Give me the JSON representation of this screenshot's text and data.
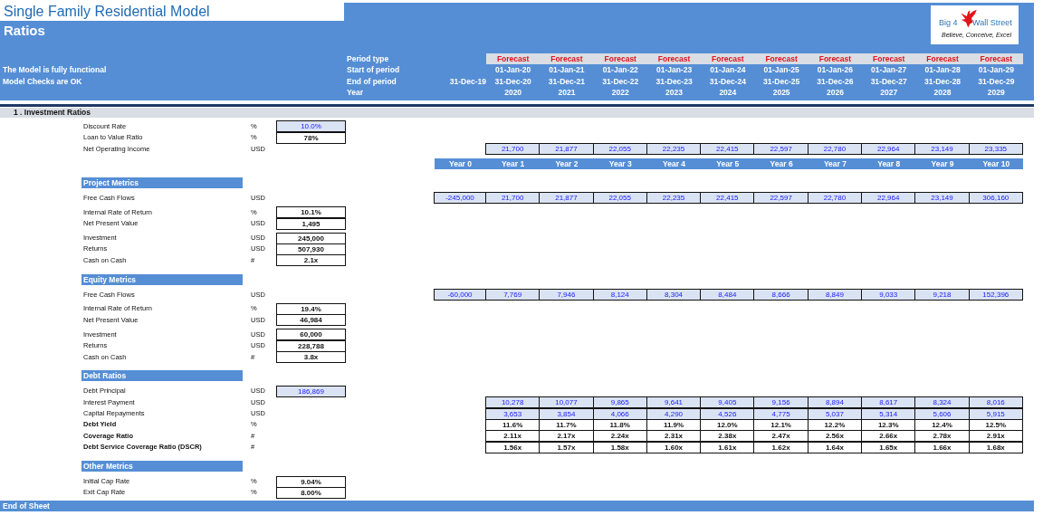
{
  "title": "Single Family Residential Model",
  "subtitle": "Ratios",
  "logo": {
    "left_text": "Big 4",
    "right_text": "Wall Street",
    "tagline": "Believe, Conceive, Excel"
  },
  "header_rows": [
    {
      "kind": "type",
      "note": "",
      "label": "Period type",
      "year0": "",
      "values": [
        "Forecast",
        "Forecast",
        "Forecast",
        "Forecast",
        "Forecast",
        "Forecast",
        "Forecast",
        "Forecast",
        "Forecast",
        "Forecast"
      ]
    },
    {
      "kind": "date",
      "note": "The Model is fully functional",
      "label": "Start of period",
      "year0": "",
      "values": [
        "01-Jan-20",
        "01-Jan-21",
        "01-Jan-22",
        "01-Jan-23",
        "01-Jan-24",
        "01-Jan-25",
        "01-Jan-26",
        "01-Jan-27",
        "01-Jan-28",
        "01-Jan-29"
      ]
    },
    {
      "kind": "date",
      "note": "Model Checks are OK",
      "label": "End of period",
      "year0": "31-Dec-19",
      "values": [
        "31-Dec-20",
        "31-Dec-21",
        "31-Dec-22",
        "31-Dec-23",
        "31-Dec-24",
        "31-Dec-25",
        "31-Dec-26",
        "31-Dec-27",
        "31-Dec-28",
        "31-Dec-29"
      ]
    },
    {
      "kind": "year",
      "note": "",
      "label": "Year",
      "year0": "",
      "values": [
        "2020",
        "2021",
        "2022",
        "2023",
        "2024",
        "2025",
        "2026",
        "2027",
        "2028",
        "2029"
      ]
    }
  ],
  "section": "1 . Investment Ratios",
  "inputs": [
    {
      "label": "Discount Rate",
      "unit": "%",
      "kind": "input",
      "label_bold": false,
      "value": "10.0%"
    },
    {
      "label": "Loan to Value Ratio",
      "unit": "%",
      "kind": "output",
      "label_bold": false,
      "value": "78%"
    },
    {
      "label": "Net Operating Income",
      "unit": "USD",
      "kind": "input",
      "label_bold": false,
      "series": [
        "21,700",
        "21,877",
        "22,055",
        "22,235",
        "22,415",
        "22,597",
        "22,780",
        "22,964",
        "23,149",
        "23,335"
      ]
    }
  ],
  "year_labels": [
    "Year 0",
    "Year 1",
    "Year 2",
    "Year 3",
    "Year 4",
    "Year 5",
    "Year 6",
    "Year 7",
    "Year 8",
    "Year 9",
    "Year 10"
  ],
  "metric_blocks": [
    {
      "heading": "Project Metrics",
      "groups": [
        [
          {
            "label": "Free Cash Flows",
            "unit": "USD",
            "kind": "input",
            "label_bold": false,
            "year0": "-245,000",
            "series": [
              "21,700",
              "21,877",
              "22,055",
              "22,235",
              "22,415",
              "22,597",
              "22,780",
              "22,964",
              "23,149",
              "306,160"
            ]
          }
        ],
        [
          {
            "label": "Internal Rate of Return",
            "unit": "%",
            "kind": "output",
            "label_bold": false,
            "value": "10.1%"
          },
          {
            "label": "Net Present Value",
            "unit": "USD",
            "kind": "output",
            "label_bold": false,
            "value": "1,495"
          }
        ],
        [
          {
            "label": "Investment",
            "unit": "USD",
            "kind": "output",
            "label_bold": false,
            "value": "245,000"
          },
          {
            "label": "Returns",
            "unit": "USD",
            "kind": "output",
            "label_bold": false,
            "value": "507,930"
          },
          {
            "label": "Cash on Cash",
            "unit": "#",
            "kind": "output",
            "label_bold": false,
            "value": "2.1x"
          }
        ]
      ]
    },
    {
      "heading": "Equity Metrics",
      "groups": [
        [
          {
            "label": "Free Cash Flows",
            "unit": "USD",
            "kind": "input",
            "label_bold": false,
            "year0": "-60,000",
            "series": [
              "7,769",
              "7,946",
              "8,124",
              "8,304",
              "8,484",
              "8,666",
              "8,849",
              "9,033",
              "9,218",
              "152,396"
            ]
          }
        ],
        [
          {
            "label": "Internal Rate of Return",
            "unit": "%",
            "kind": "output",
            "label_bold": false,
            "value": "19.4%"
          },
          {
            "label": "Net Present Value",
            "unit": "USD",
            "kind": "output",
            "label_bold": false,
            "value": "46,984"
          }
        ],
        [
          {
            "label": "Investment",
            "unit": "USD",
            "kind": "output",
            "label_bold": false,
            "value": "60,000"
          },
          {
            "label": "Returns",
            "unit": "USD",
            "kind": "output",
            "label_bold": false,
            "value": "228,788"
          },
          {
            "label": "Cash on Cash",
            "unit": "#",
            "kind": "output",
            "label_bold": false,
            "value": "3.8x"
          }
        ]
      ]
    },
    {
      "heading": "Debt Ratios",
      "groups": [
        [
          {
            "label": "Debt Principal",
            "unit": "USD",
            "kind": "input",
            "label_bold": false,
            "value": "186,869"
          },
          {
            "label": "Interest Payment",
            "unit": "USD",
            "kind": "input",
            "label_bold": false,
            "series": [
              "10,278",
              "10,077",
              "9,865",
              "9,641",
              "9,405",
              "9,156",
              "8,894",
              "8,617",
              "8,324",
              "8,016"
            ]
          },
          {
            "label": "Capital Repayments",
            "unit": "USD",
            "kind": "input",
            "label_bold": false,
            "series": [
              "3,653",
              "3,854",
              "4,066",
              "4,290",
              "4,526",
              "4,775",
              "5,037",
              "5,314",
              "5,606",
              "5,915"
            ]
          },
          {
            "label": "Debt Yield",
            "unit": "%",
            "kind": "output",
            "label_bold": true,
            "series": [
              "11.6%",
              "11.7%",
              "11.8%",
              "11.9%",
              "12.0%",
              "12.1%",
              "12.2%",
              "12.3%",
              "12.4%",
              "12.5%"
            ]
          },
          {
            "label": "Coverage Ratio",
            "unit": "#",
            "kind": "output",
            "label_bold": true,
            "series": [
              "2.11x",
              "2.17x",
              "2.24x",
              "2.31x",
              "2.38x",
              "2.47x",
              "2.56x",
              "2.66x",
              "2.78x",
              "2.91x"
            ]
          },
          {
            "label": "Debt Service Coverage Ratio (DSCR)",
            "unit": "#",
            "kind": "output",
            "label_bold": true,
            "series": [
              "1.56x",
              "1.57x",
              "1.58x",
              "1.60x",
              "1.61x",
              "1.62x",
              "1.64x",
              "1.65x",
              "1.66x",
              "1.68x"
            ]
          }
        ]
      ]
    },
    {
      "heading": "Other Metrics",
      "groups": [
        [
          {
            "label": "Initial Cap Rate",
            "unit": "%",
            "kind": "output",
            "label_bold": false,
            "value": "9.04%"
          },
          {
            "label": "Exit Cap Rate",
            "unit": "%",
            "kind": "output",
            "label_bold": false,
            "value": "8.00%"
          }
        ]
      ]
    }
  ],
  "end_label": "End of Sheet"
}
